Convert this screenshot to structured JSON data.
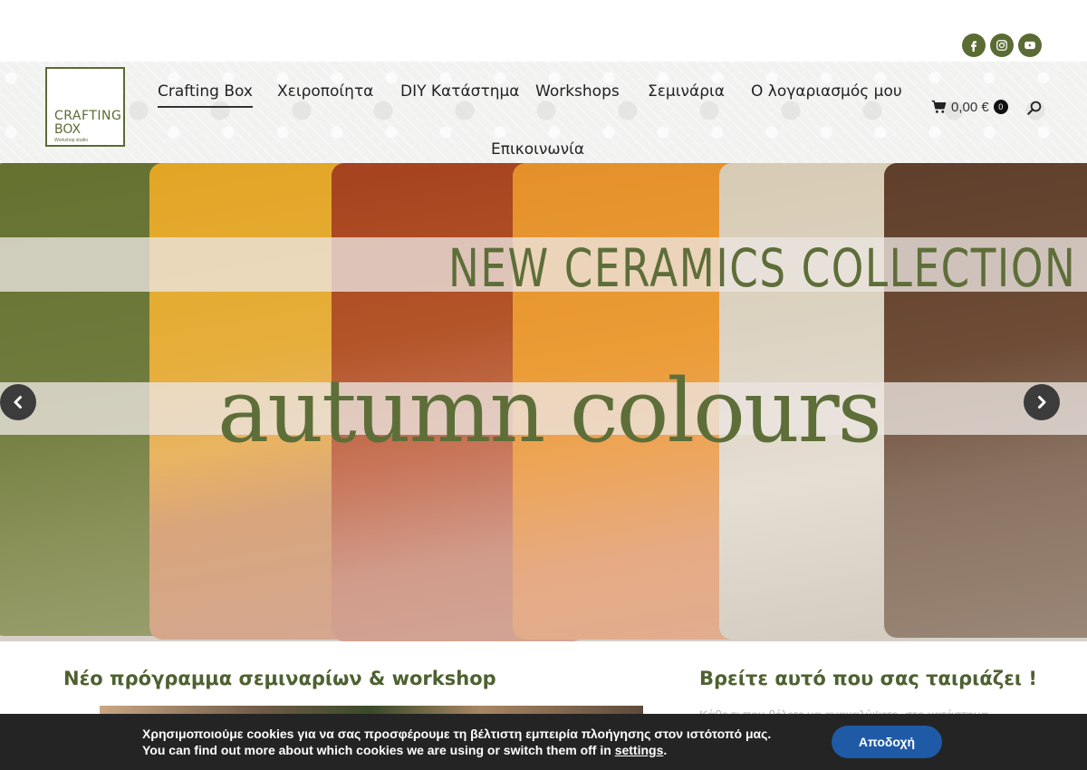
{
  "social": [
    {
      "icon": "facebook-icon"
    },
    {
      "icon": "instagram-icon"
    },
    {
      "icon": "youtube-icon"
    }
  ],
  "logo": {
    "line1": "CRAFTING",
    "line2": "BOX",
    "tagline": "Workshop studio"
  },
  "nav": {
    "items": [
      {
        "label": "Crafting Box",
        "active": true
      },
      {
        "label": "Χειροποίητα"
      },
      {
        "label": "DIY Κατάστημα"
      },
      {
        "label": "Workshops"
      },
      {
        "label": "Σεμινάρια"
      },
      {
        "label": "Ο λογαριασμός μου"
      },
      {
        "label": "Επικοινωνία"
      }
    ]
  },
  "cart": {
    "total": "0,00 €",
    "count": "0"
  },
  "hero": {
    "title": "NEW CERAMICS COLLECTION",
    "subtitle": "autumn colours",
    "swatches": [
      "#6f7a3a",
      "#e0a42a",
      "#b4562a",
      "#e89a33",
      "#d7cdb9",
      "#6b4a35"
    ]
  },
  "sections": {
    "left_heading": "Νέο πρόγραμμα σεμιναρίων & workshop",
    "right_heading": "Βρείτε αυτό που σας ταιριάζει !",
    "right_text": "Κάθε τι που θέλετε να ανακαλύψετε, στο κατάστημα"
  },
  "cookie": {
    "line1": "Χρησιμοποιούμε cookies για να σας προσφέρουμε τη βέλτιστη εμπειρία πλοήγησης στον ιστότοπό μας.",
    "line2": "You can find out more about which cookies we are using or switch them off in",
    "link": "settings",
    "accept": "Αποδοχή"
  },
  "colors": {
    "brand": "#5a6b34",
    "accent_button": "#1f5aa6",
    "cookie_bg": "#242424"
  }
}
